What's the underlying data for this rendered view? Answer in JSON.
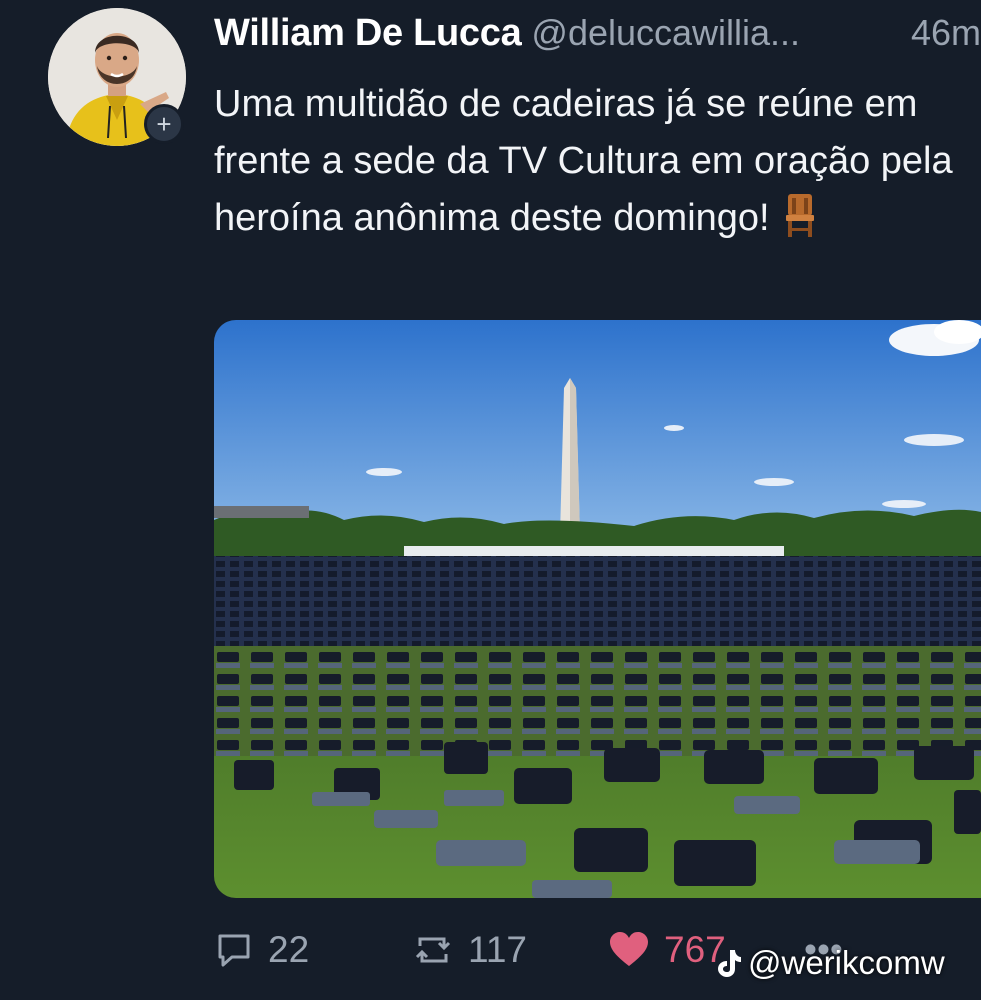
{
  "tweet": {
    "author_name": "William De Lucca",
    "author_handle": "@deluccawillia...",
    "time": "46m",
    "text": "Uma multidão de cadeiras já se reúne em frente a sede da TV Cultura em oração pela heroína anônima deste domingo!",
    "emoji": "chair-emoji",
    "follow_symbol": "+"
  },
  "actions": {
    "replies": "22",
    "retweets": "117",
    "likes": "767",
    "more_symbol": "•••"
  },
  "watermark": {
    "text": "@werikcomw"
  },
  "colors": {
    "background": "#151d29",
    "muted_text": "#9aa4b1",
    "like_color": "#e0607e",
    "sky": "#3f86d8",
    "grass": "#4e7d2a",
    "chairs": "#1f2535"
  }
}
